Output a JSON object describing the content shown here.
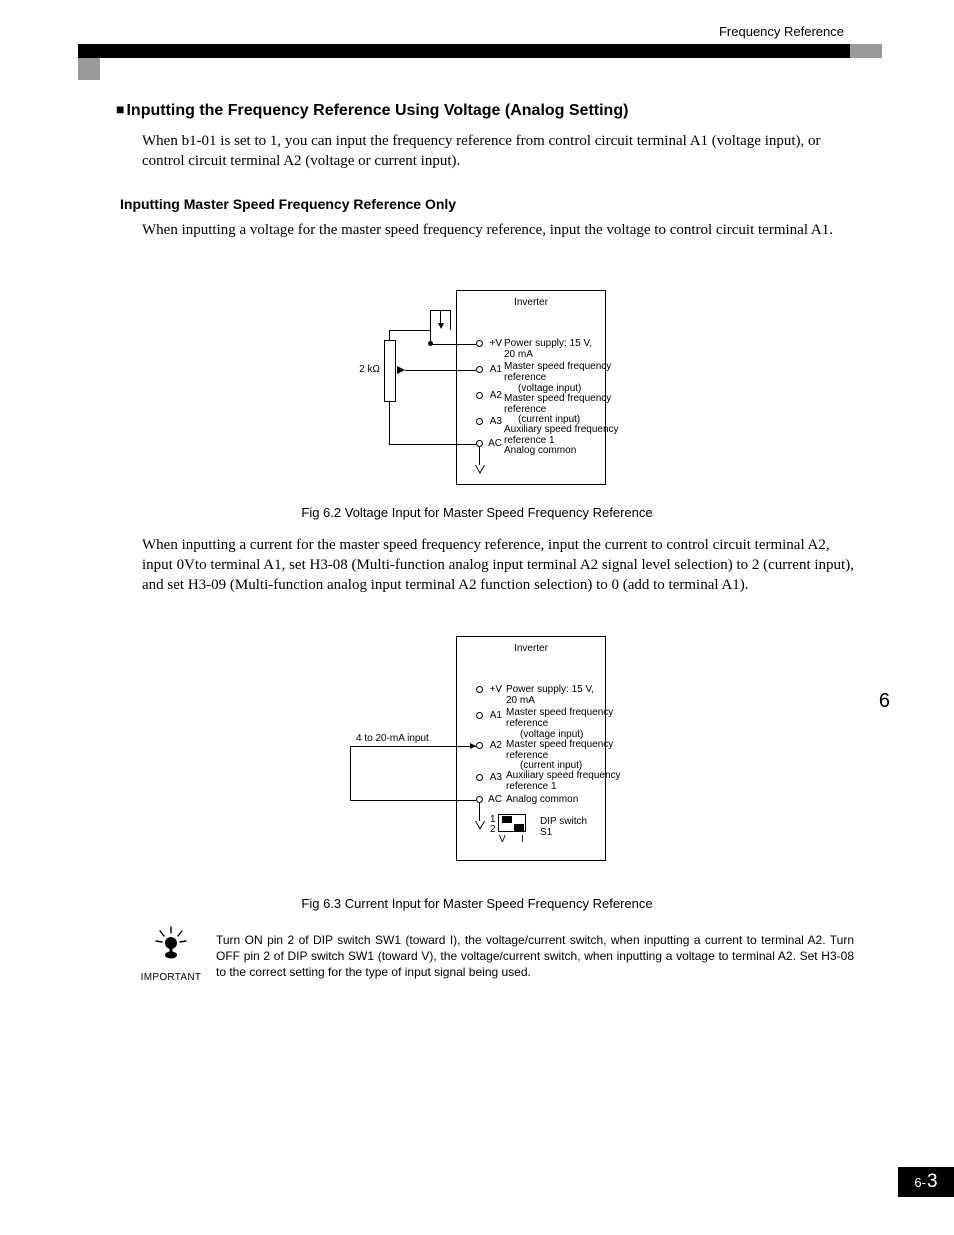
{
  "header_label": "Frequency Reference",
  "h1": "Inputting the Frequency Reference Using Voltage (Analog Setting)",
  "p1": "When b1-01 is set to 1, you can input the frequency reference from control circuit terminal A1 (voltage input), or control circuit terminal A2 (voltage or current input).",
  "h2": "Inputting Master Speed Frequency Reference Only",
  "p2": "When inputting a voltage for the master speed frequency reference, input the voltage to control circuit terminal A1.",
  "fig62_caption": "Fig 6.2   Voltage Input for Master Speed Frequency Reference",
  "p3": "When inputting a current for the master speed frequency reference, input the current to control circuit terminal A2, input 0Vto terminal A1, set H3-08 (Multi-function analog input terminal A2 signal level selection) to 2 (current input), and set H3-09 (Multi-function analog input terminal A2 function selection) to 0 (add to terminal A1).",
  "fig63_caption": "Fig 6.3   Current Input for Master Speed Frequency Reference",
  "important_label": "IMPORTANT",
  "important_text": "Turn ON pin 2 of DIP switch SW1 (toward I), the voltage/current switch, when inputting a current to terminal A2. Turn OFF pin 2 of DIP switch SW1 (toward V), the voltage/current switch, when inputting a voltage to terminal A2. Set H3-08 to the correct setting for the type of input signal being used.",
  "chapter_side": "6",
  "page_prefix": "6-",
  "page_number": "3",
  "diagram": {
    "pot_label": "2 kΩ",
    "current_label": "4 to 20-mA input",
    "inverter": "Inverter",
    "pV": "+V",
    "pA1": "A1",
    "pA2": "A2",
    "pA3": "A3",
    "pAC": "AC",
    "lV_a": "Power supply: 15 V,",
    "lV_b": "20 mA",
    "lA1_a": "Master speed frequency",
    "lA1_b": "reference",
    "lA1_c": "(voltage input)",
    "lA2_a": "Master speed frequency",
    "lA2_b": "reference",
    "lA2_c": "(current input)",
    "lA3_a": "Auxiliary speed frequency",
    "lA3_b": "reference 1",
    "lAC": "Analog common",
    "dip1": "1",
    "dip2": "2",
    "dipV": "V",
    "dipI": "I",
    "dip_lbl_a": "DIP switch",
    "dip_lbl_b": "S1"
  }
}
